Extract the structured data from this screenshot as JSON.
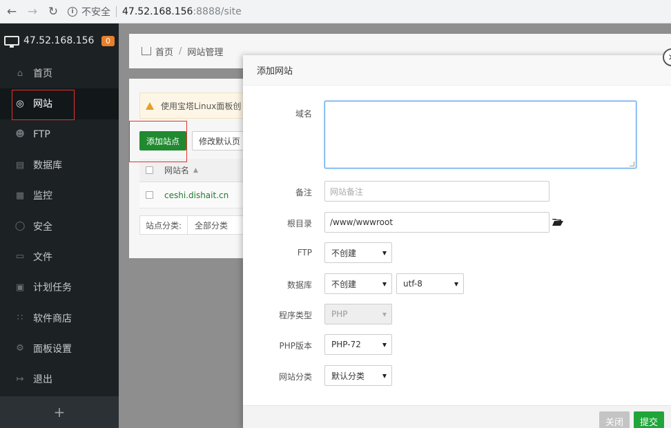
{
  "browser": {
    "back_icon": "arrow-left-icon",
    "forward_icon": "arrow-right-icon",
    "reload_icon": "reload-icon",
    "insecure_label": "不安全",
    "url_host": "47.52.168.156",
    "url_path": ":8888/site"
  },
  "sidebar": {
    "server_ip": "47.52.168.156",
    "badge_count": "0",
    "items": [
      {
        "label": "首页",
        "icon": "home-icon"
      },
      {
        "label": "网站",
        "icon": "globe-icon"
      },
      {
        "label": "FTP",
        "icon": "ftp-icon"
      },
      {
        "label": "数据库",
        "icon": "database-icon"
      },
      {
        "label": "监控",
        "icon": "monitor-icon"
      },
      {
        "label": "安全",
        "icon": "shield-icon"
      },
      {
        "label": "文件",
        "icon": "folder-icon"
      },
      {
        "label": "计划任务",
        "icon": "calendar-icon"
      },
      {
        "label": "软件商店",
        "icon": "grid-icon"
      },
      {
        "label": "面板设置",
        "icon": "gear-icon"
      },
      {
        "label": "退出",
        "icon": "logout-icon"
      }
    ],
    "add_label": "+"
  },
  "breadcrumb": {
    "home": "首页",
    "separator": "/",
    "current": "网站管理"
  },
  "site_panel": {
    "warning_text": "使用宝塔Linux面板创",
    "add_site_button": "添加站点",
    "modify_default_button": "修改默认页",
    "table_header_name": "网站名",
    "rows": [
      {
        "name": "ceshi.dishait.cn"
      }
    ],
    "category_label": "站点分类:",
    "category_value": "全部分类"
  },
  "modal": {
    "title": "添加网站",
    "close_glyph": "×",
    "fields": {
      "domain_label": "域名",
      "domain_value": "",
      "remark_label": "备注",
      "remark_placeholder": "网站备注",
      "root_label": "根目录",
      "root_value": "/www/wwwroot",
      "ftp_label": "FTP",
      "ftp_value": "不创建",
      "db_label": "数据库",
      "db_value": "不创建",
      "db_charset": "utf-8",
      "program_type_label": "程序类型",
      "program_type_value": "PHP",
      "php_version_label": "PHP版本",
      "php_version_value": "PHP-72",
      "site_category_label": "网站分类",
      "site_category_value": "默认分类"
    },
    "close_button": "关闭",
    "submit_button": "提交"
  },
  "colors": {
    "sidebar_bg": "#1c2123",
    "accent_green": "#20a53a",
    "highlight_red": "#e8302b",
    "badge_orange": "#e8802a"
  }
}
